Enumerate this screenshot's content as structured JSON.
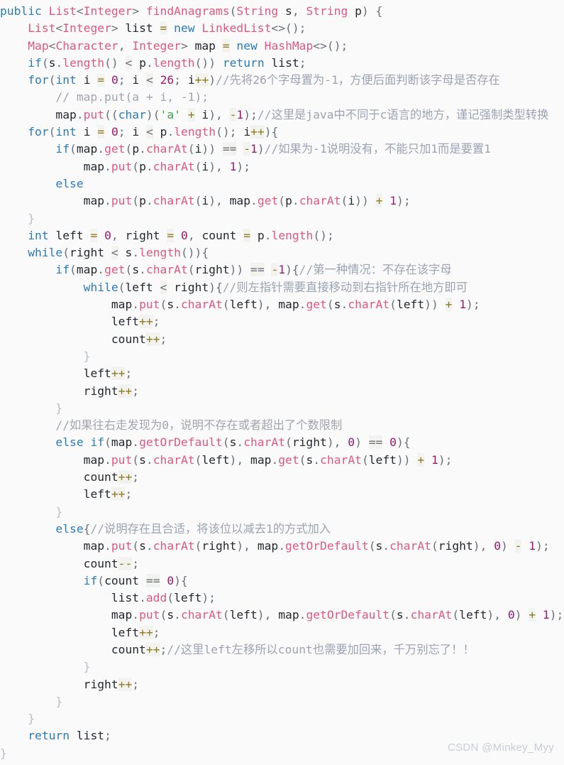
{
  "editor": {
    "language": "java",
    "background_color": "#fafafa",
    "theme_colors": {
      "keyword": "#2b7bb9",
      "type": "#e0577f",
      "method": "#e0577f",
      "number": "#9c1a6e",
      "string": "#3ea34a",
      "comment": "#9aa4b2",
      "punctuation": "#6a7078",
      "identifier": "#24292e",
      "operator": "#8a7a1f"
    },
    "code_lines": [
      "public List<Integer> findAnagrams(String s, String p) {",
      "    List<Integer> list = new LinkedList<>();",
      "    Map<Character, Integer> map = new HashMap<>();",
      "    if(s.length() < p.length()) return list;",
      "    for(int i = 0; i < 26; i++)//先将26个字母置为-1，方便后面判断该字母是否存在",
      "        // map.put(a + i, -1);",
      "        map.put((char)('a' + i), -1);//这里是java中不同于c语言的地方，谨记强制类型转换",
      "    for(int i = 0; i < p.length(); i++){",
      "        if(map.get(p.charAt(i)) == -1)//如果为-1说明没有，不能只加1而是要置1",
      "            map.put(p.charAt(i), 1);",
      "        else",
      "            map.put(p.charAt(i), map.get(p.charAt(i)) + 1);",
      "    }",
      "    int left = 0, right = 0, count = p.length();",
      "    while(right < s.length()){",
      "        if(map.get(s.charAt(right)) == -1){//第一种情况：不存在该字母",
      "            while(left < right){//则左指针需要直接移动到右指针所在地方即可",
      "                map.put(s.charAt(left), map.get(s.charAt(left)) + 1);",
      "                left++;",
      "                count++;",
      "            }",
      "            left++;",
      "            right++;",
      "        }",
      "        //如果往右走发现为0，说明不存在或者超出了个数限制",
      "        else if(map.getOrDefault(s.charAt(right), 0) == 0){",
      "            map.put(s.charAt(left), map.get(s.charAt(left)) + 1);",
      "            count++;",
      "            left++;",
      "        }",
      "        else{//说明存在且合适，将该位以减去1的方式加入",
      "            map.put(s.charAt(right), map.getOrDefault(s.charAt(right), 0) - 1);",
      "            count--;",
      "            if(count == 0){",
      "                list.add(left);",
      "                map.put(s.charAt(left), map.getOrDefault(s.charAt(left), 0) + 1);",
      "                left++;",
      "                count++;//这里left左移所以count也需要加回来，千万别忘了！！",
      "            }",
      "            right++;",
      "        }",
      "    }",
      "    return list;",
      "}"
    ],
    "watermark": "CSDN @Minkey_Myy"
  }
}
